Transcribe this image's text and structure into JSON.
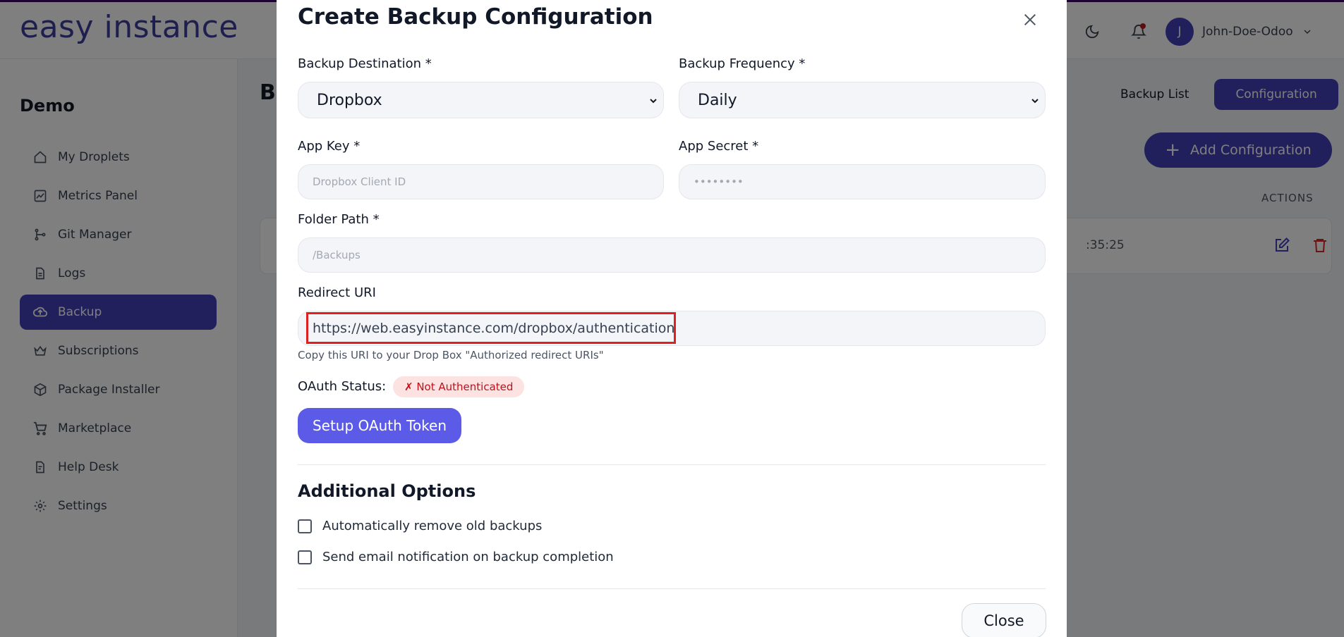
{
  "app": {
    "logo_text": "easy instance",
    "brand_color": "#4340b8",
    "user": {
      "initial": "J",
      "name": "John-Doe-Odoo"
    }
  },
  "sidebar": {
    "title": "Demo",
    "items": [
      {
        "label": "My Droplets",
        "icon": "home-icon"
      },
      {
        "label": "Metrics Panel",
        "icon": "chart-icon"
      },
      {
        "label": "Git Manager",
        "icon": "git-branch-icon"
      },
      {
        "label": "Logs",
        "icon": "document-icon"
      },
      {
        "label": "Backup",
        "icon": "cloud-upload-icon",
        "active": true
      },
      {
        "label": "Subscriptions",
        "icon": "crown-icon"
      },
      {
        "label": "Package Installer",
        "icon": "package-icon"
      },
      {
        "label": "Marketplace",
        "icon": "cart-icon"
      },
      {
        "label": "Help Desk",
        "icon": "help-document-icon"
      },
      {
        "label": "Settings",
        "icon": "gear-icon"
      }
    ]
  },
  "main": {
    "page_title_visible": "Ba",
    "tabs": [
      {
        "label": "Backup List"
      },
      {
        "label": "Configuration",
        "active": true
      }
    ],
    "add_button": "Add Configuration",
    "actions_header": "ACTIONS",
    "row_time_visible": ":35:25"
  },
  "modal": {
    "title": "Create Backup Configuration",
    "destination": {
      "label": "Backup Destination *",
      "value": "Dropbox"
    },
    "frequency": {
      "label": "Backup Frequency *",
      "value": "Daily"
    },
    "app_key": {
      "label": "App Key *",
      "placeholder": "Dropbox Client ID"
    },
    "app_secret": {
      "label": "App Secret *",
      "placeholder": "••••••••"
    },
    "folder_path": {
      "label": "Folder Path *",
      "placeholder": "/Backups"
    },
    "redirect_uri": {
      "label": "Redirect URI",
      "value": "https://web.easyinstance.com/dropbox/authentication",
      "helper": "Copy this URI to your Drop Box \"Authorized redirect URIs\""
    },
    "oauth": {
      "label": "OAuth Status:",
      "status": "✗ Not Authenticated",
      "button": "Setup OAuth Token"
    },
    "additional": {
      "title": "Additional Options",
      "options": [
        {
          "label": "Automatically remove old backups",
          "checked": false
        },
        {
          "label": "Send email notification on backup completion",
          "checked": false
        }
      ]
    },
    "close_button": "Close"
  }
}
